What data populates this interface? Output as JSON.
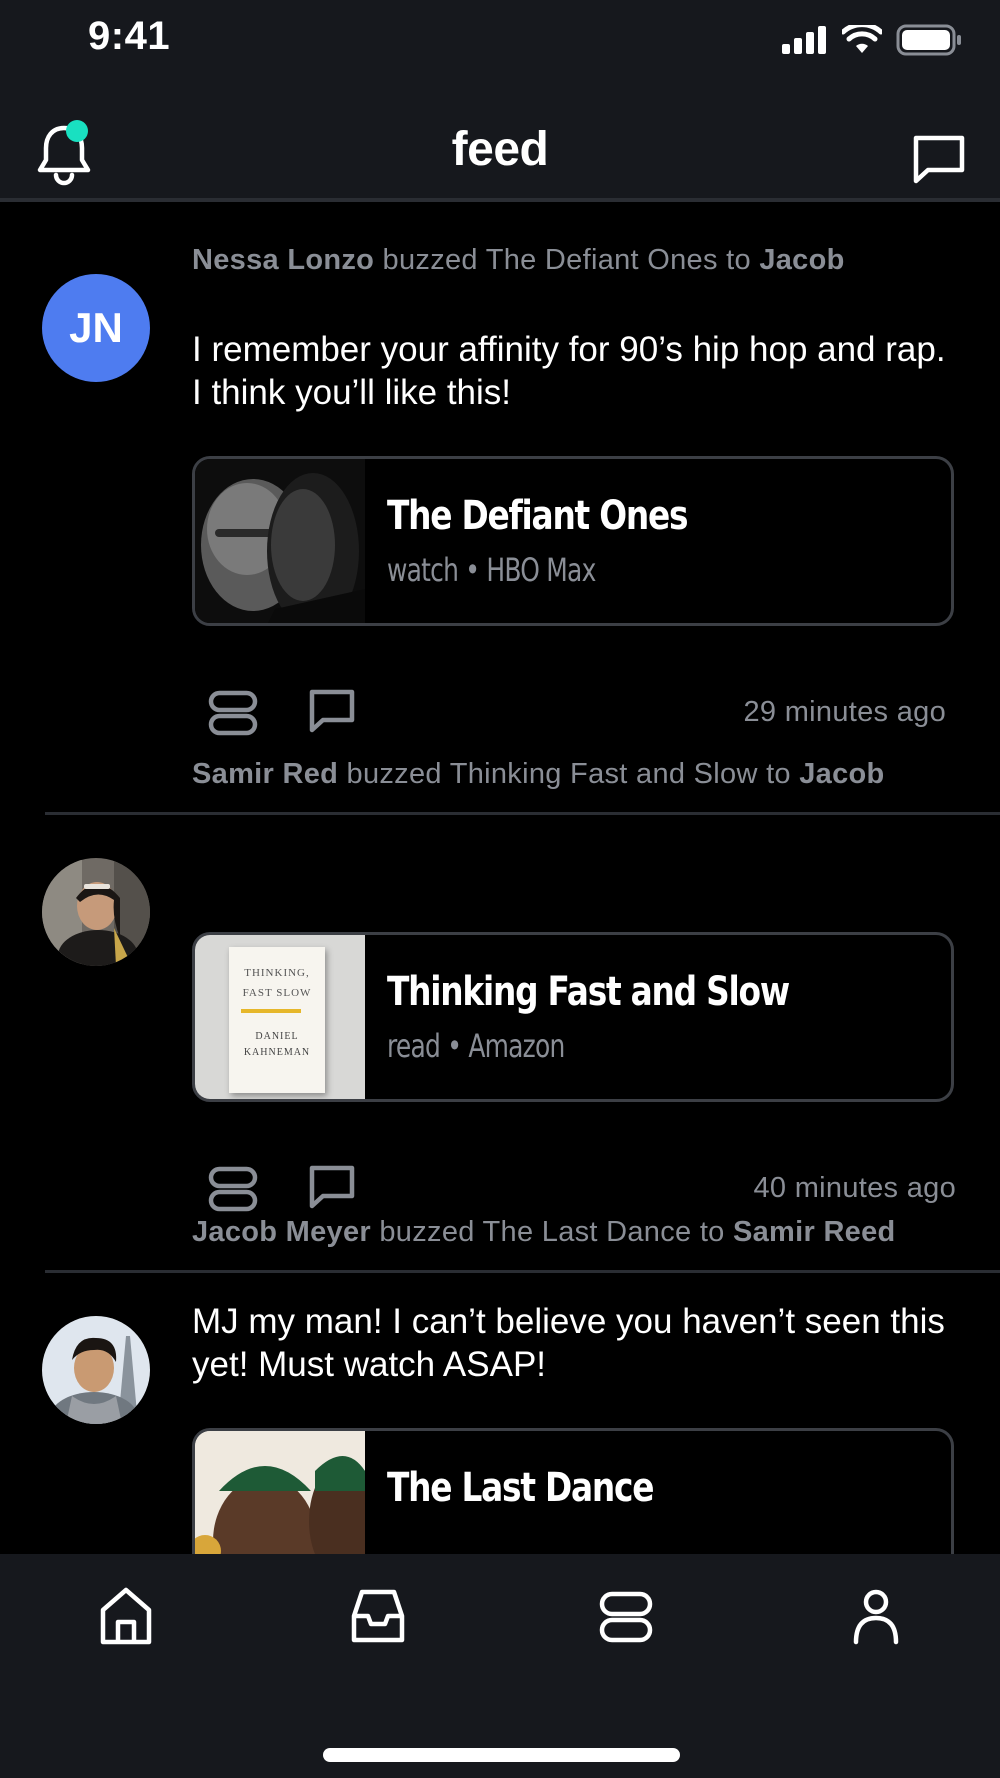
{
  "status_bar": {
    "time": "9:41"
  },
  "header": {
    "title": "feed"
  },
  "posts": [
    {
      "avatar_initials": "JN",
      "sender": "Nessa Lonzo",
      "verb": "buzzed",
      "item": "The Defiant Ones",
      "to_word": "to",
      "recipient": "Jacob",
      "message": "I remember your affinity for 90’s hip hop and rap. I think you’ll like this!",
      "card": {
        "title": "The Defiant Ones",
        "subtitle": "watch • HBO Max"
      },
      "time": "29 minutes ago"
    },
    {
      "sender": "Samir Red",
      "verb": "buzzed",
      "item": "Thinking Fast and Slow",
      "to_word": "to",
      "recipient": "Jacob",
      "card": {
        "title": "Thinking Fast and Slow",
        "subtitle": "read • Amazon",
        "cover": {
          "line1": "THINKING,",
          "line2": "FAST",
          "line3": "SLOW",
          "author1": "DANIEL",
          "author2": "KAHNEMAN"
        }
      },
      "time": "40 minutes ago"
    },
    {
      "sender": "Jacob Meyer",
      "verb": "buzzed",
      "item": "The Last Dance",
      "to_word": "to",
      "recipient": "Samir Reed",
      "message": "MJ my man! I can’t believe you haven’t seen this yet! Must watch ASAP!",
      "card": {
        "title": "The Last Dance"
      }
    }
  ],
  "tabs": [
    "home",
    "inbox",
    "buzz",
    "profile"
  ],
  "colors": {
    "accent": "#19e0c1",
    "avatar_blue": "#4e7cf0",
    "muted_text": "#8a8e96",
    "bar_bg": "#16181d"
  }
}
